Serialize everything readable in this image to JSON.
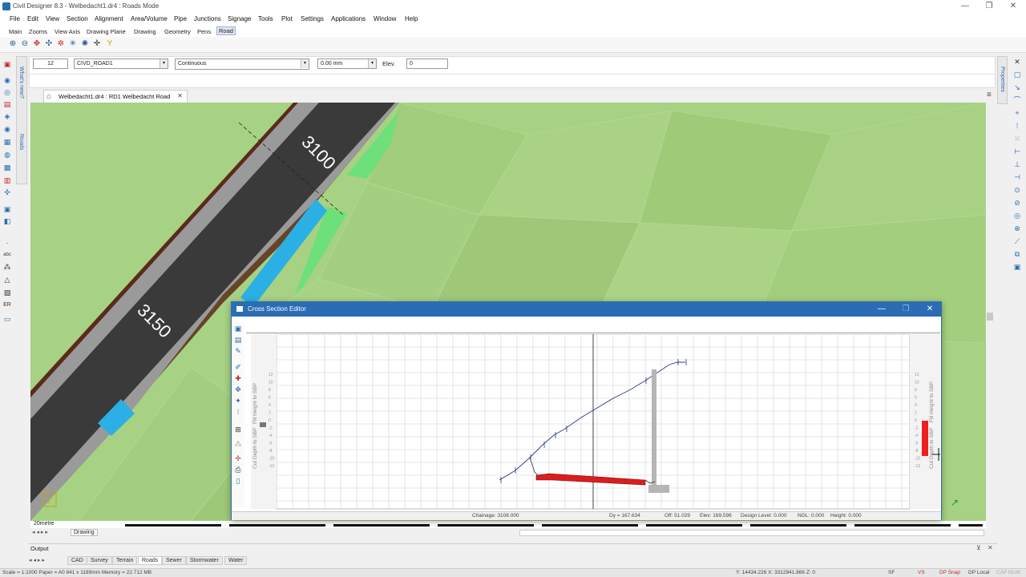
{
  "window": {
    "title": "Civil Designer 8.3 - Welbedacht1.dr4 : Roads Mode",
    "controls": [
      "—",
      "❐",
      "✕"
    ]
  },
  "menu": [
    "File",
    "Edit",
    "View",
    "Section",
    "Alignment",
    "Area/Volume",
    "Pipe",
    "Junctions",
    "Signage",
    "Tools",
    "Plot",
    "Settings",
    "Applications",
    "Window",
    "Help"
  ],
  "ribbon_tabs": [
    "Main",
    "Zooms",
    "View Axis",
    "Drawing Plane",
    "Drawing",
    "Geometry",
    "Pens",
    "Road"
  ],
  "properties_bar": {
    "pen_number": "12",
    "layer": "CIVD_ROAD1",
    "linetype": "Continuous",
    "width": "0.00 mm",
    "elev_label": "Elev.",
    "elev_value": "0"
  },
  "side_tabs": {
    "whats_new": "What's new?",
    "roads": "Roads",
    "properties": "Properties"
  },
  "document_tab": {
    "label": "Welbedacht1.dr4 : RD1 Welbedacht Road",
    "close": "✕"
  },
  "drawing": {
    "chainage_labels": [
      "3100",
      "3150"
    ],
    "scale_label": "20metre",
    "sheet_tab": "Drawing",
    "ucs_glyph": "T"
  },
  "cross_section_editor": {
    "title": "Cross Section Editor",
    "left_axis_label": "Cut Depth to SBP",
    "left_axis_label2": "Fill Height to SBP",
    "right_axis_label": "Cut Depth to SBP",
    "right_axis_label2": "Fill Height to SBP",
    "left_ticks": [
      "12",
      "10",
      "8",
      "6",
      "4",
      "2",
      "0",
      "-2",
      "-4",
      "-6",
      "-8",
      "-10",
      "-12"
    ],
    "status": {
      "chainage": "Chainage: 3108.000",
      "dy": "Dy = 167.634",
      "off": "Off: 51.029",
      "elev": "Elev: 169.596",
      "design_level": "Design Level: 0.000",
      "ngl": "NGL: 0.000",
      "height": "Height: 0.000"
    }
  },
  "output_panel": {
    "title": "Output",
    "tabs": [
      "CAD",
      "Survey",
      "Terrain",
      "Roads",
      "Sewer",
      "Stormwater",
      "Water"
    ],
    "active_tab": "Roads"
  },
  "status_bar": {
    "scale": "Scale = 1:1000  Paper = A0 841 x 1189mm  Memory = 22.712 MB",
    "coords": "Y: 14434.226 X: 3312941.866 Z: 0",
    "sf": "SF",
    "vs": "VS",
    "dp_snap": "DP Snap",
    "dp_local": "DP Local",
    "cap_num": "CAP NUM"
  },
  "colors": {
    "terrain": "#a7d183",
    "road": "#3a3a3a",
    "shoulder": "#9a9a9a",
    "cut_fill_blue": "#2ab0e4",
    "fill_green": "#6ee07a",
    "boundary": "#5a2a1a",
    "accent": "#2a6db5",
    "cut_red": "#d81e1e"
  }
}
